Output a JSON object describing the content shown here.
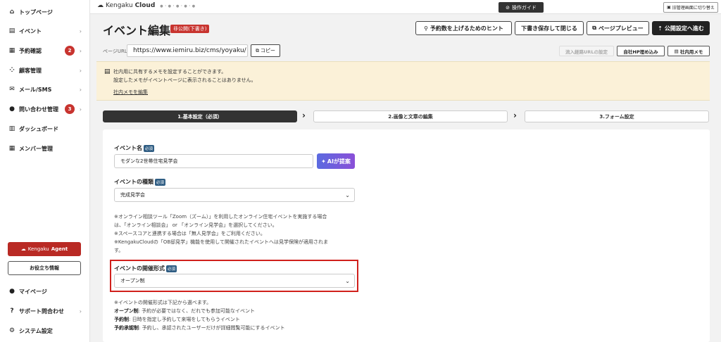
{
  "sidebar": {
    "items": [
      {
        "label": "トップページ",
        "icon": "home-icon"
      },
      {
        "label": "イベント",
        "icon": "document-icon"
      },
      {
        "label": "予約確認",
        "icon": "calendar-icon",
        "badge": "2"
      },
      {
        "label": "顧客管理",
        "icon": "people-icon"
      },
      {
        "label": "メール/SMS",
        "icon": "mail-icon"
      },
      {
        "label": "問い合わせ管理",
        "icon": "chat-icon",
        "badge": "3"
      },
      {
        "label": "ダッシュボード",
        "icon": "chart-icon"
      },
      {
        "label": "メンバー管理",
        "icon": "grid-icon"
      }
    ],
    "agent_button": {
      "prefix": "Kengaku",
      "bold": "Agent"
    },
    "info_button": "お役立ち情報",
    "bottom_items": [
      {
        "label": "マイページ",
        "icon": "user-icon"
      },
      {
        "label": "サポート問合わせ",
        "icon": "help-icon"
      },
      {
        "label": "システム設定",
        "icon": "gear-icon"
      }
    ]
  },
  "topbar": {
    "logo_prefix": "Kengaku",
    "logo_bold": "Cloud",
    "logo_dots": "●・●・●・●・●",
    "guide_button": "操作ガイド",
    "switch_button": "旧管理画面に切り替え"
  },
  "header": {
    "title": "イベント編集",
    "status_badge": "非公開(下書き)",
    "buttons": {
      "hint": "予約数を上げるためのヒント",
      "save_close": "下書き保存して閉じる",
      "preview": "ページプレビュー",
      "next": "公開設定へ進む"
    }
  },
  "url_row": {
    "label": "ページURL",
    "value": "https://www.iemiru.biz/cms/yoyaku/",
    "copy_button": "コピー",
    "inflow_button": "流入経路URLの設定",
    "embed_button": "自社HP埋め込み",
    "memo_button": "社内用メモ"
  },
  "memo": {
    "line1": "社内用に共有するメモを設定することができます。",
    "line2": "設定したメモがイベントページに表示されることはありません。",
    "link": "社内メモを編集"
  },
  "steps": [
    {
      "label": "1.基本設定（必須）",
      "active": true
    },
    {
      "label": "2.画像と文章の編集",
      "active": false
    },
    {
      "label": "3.フォーム設定",
      "active": false
    }
  ],
  "form": {
    "required_tag": "必須",
    "event_name": {
      "label": "イベント名",
      "value": "モダンな2世帯住宅見学会"
    },
    "ai_button": "AIが提案",
    "event_type": {
      "label": "イベントの種類",
      "value": "完成見学会"
    },
    "type_notes": [
      "※オンライン相談ツール「Zoom（ズーム）」を利用したオンライン住宅イベントを実施する場合",
      "は、「オンライン相談会」 or 「オンライン見学会」を選択してください。",
      "※スペースコアと連携する場合は「無人見学会」をご利用ください。",
      "※KengakuCloudの「OB邸見学」機能を使用して開催されたイベントへは見学保険が適用されま",
      "す。"
    ],
    "format": {
      "label": "イベントの開催形式",
      "value": "オープン制"
    },
    "format_notes": {
      "intro": "※イベントの開催形式は下記から選べます。",
      "open_label": "オープン制",
      "open_text": ": 予約が必要ではなく、だれでも参加可能なイベント",
      "reserve_label": "予約制",
      "reserve_text": ": 日時を指定し予約して来場をしてもらうイベント",
      "approval_label": "予約承認制",
      "approval_text": ": 予約し、承認されたユーザーだけが詳細閲覧可能にするイベント"
    }
  }
}
